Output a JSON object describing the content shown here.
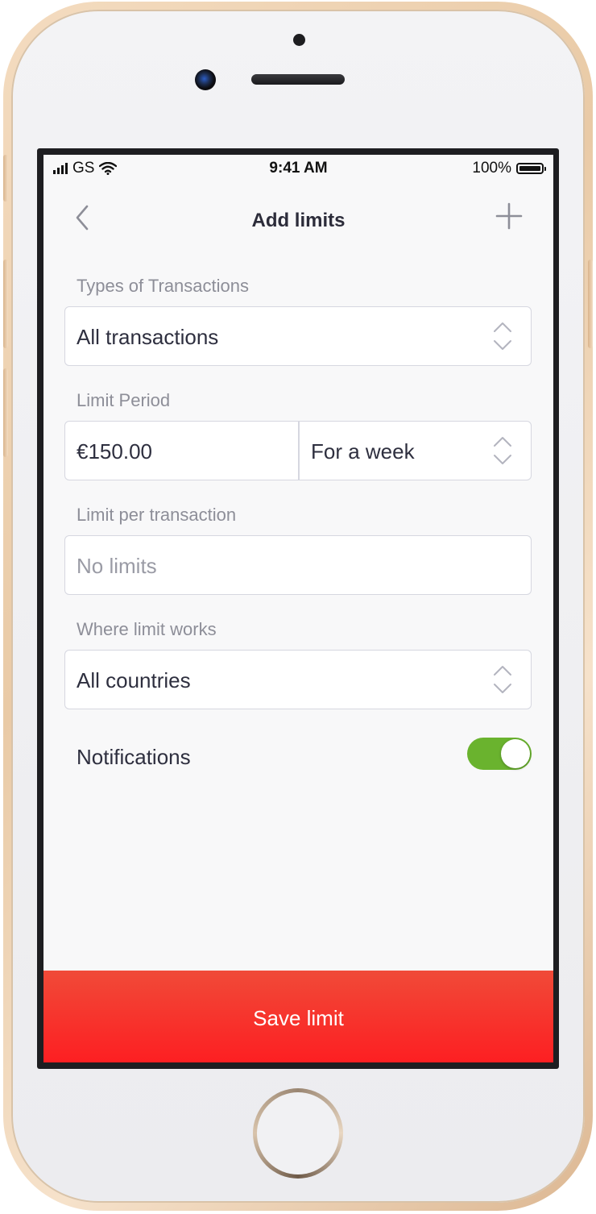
{
  "status_bar": {
    "carrier": "GS",
    "time": "9:41 AM",
    "battery": "100%",
    "icons": [
      "signal-icon",
      "wifi-icon",
      "battery-icon"
    ]
  },
  "nav": {
    "title": "Add limits",
    "back_icon": "chevron-left-icon",
    "add_icon": "plus-icon"
  },
  "form": {
    "types_label": "Types of Transactions",
    "types_value": "All transactions",
    "period_label": "Limit Period",
    "period_amount": "€150.00",
    "period_value": "For a week",
    "per_tx_label": "Limit per transaction",
    "per_tx_placeholder": "No limits",
    "where_label": "Where limit works",
    "where_value": "All countries",
    "notifications_label": "Notifications",
    "notifications_on": true
  },
  "save_label": "Save limit",
  "colors": {
    "accent_red": "#fd1f22",
    "toggle_green": "#6ab32e",
    "text_dark": "#2e2f3f",
    "label_gray": "#8d8e98"
  }
}
